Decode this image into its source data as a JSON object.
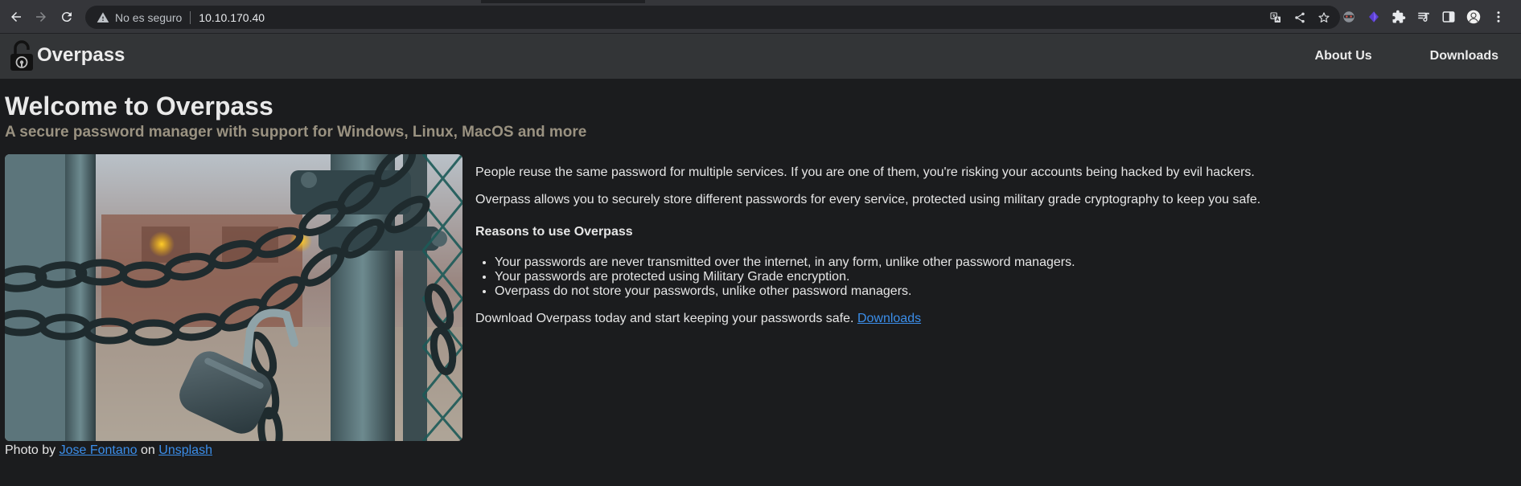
{
  "browser": {
    "security_label": "No es seguro",
    "url": "10.10.170.40",
    "icons": {
      "back": "arrow-left-icon",
      "forward": "arrow-right-icon",
      "reload": "reload-icon",
      "warning": "warning-icon",
      "translate": "translate-icon",
      "share": "share-icon",
      "bookmark": "star-icon",
      "extensions": [
        "mask-extension-icon",
        "purple-diamond-extension-icon",
        "puzzle-icon",
        "media-playlist-icon",
        "side-panel-icon",
        "profile-avatar-icon",
        "kebab-menu-icon"
      ]
    }
  },
  "site": {
    "brand": "Overpass",
    "nav": [
      "About Us",
      "Downloads"
    ]
  },
  "page": {
    "title": "Welcome to Overpass",
    "tagline": "A secure password manager with support for Windows, Linux, MacOS and more",
    "paragraph1": "People reuse the same password for multiple services. If you are one of them, you're risking your accounts being hacked by evil hackers.",
    "paragraph2": "Overpass allows you to securely store different passwords for every service, protected using military grade cryptography to keep you safe.",
    "reasons_title": "Reasons to use Overpass",
    "reasons": [
      "Your passwords are never transmitted over the internet, in any form, unlike other password managers.",
      "Your passwords are protected using Military Grade encryption.",
      "Overpass do not store your passwords, unlike other password managers."
    ],
    "cta_text": "Download Overpass today and start keeping your passwords safe.",
    "cta_link": "Downloads",
    "credit_prefix": "Photo by",
    "credit_author": "Jose Fontano",
    "credit_on": "on",
    "credit_site": "Unsplash"
  },
  "colors": {
    "page_bg": "#1b1c1e",
    "navbar_bg": "#333537",
    "link": "#3b8eea",
    "tagline": "#9a9281"
  }
}
